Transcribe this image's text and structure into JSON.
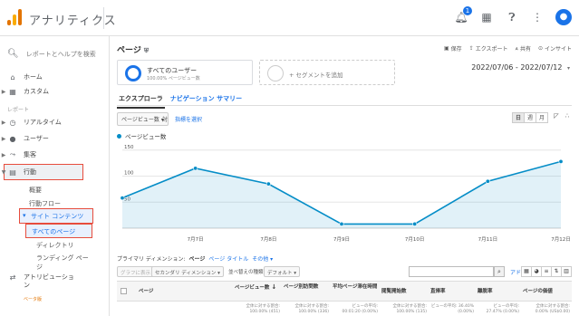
{
  "app": {
    "title": "アナリティクス"
  },
  "header": {
    "notification_count": "1"
  },
  "sidebar": {
    "search_placeholder": "レポートとヘルプを検索",
    "home": "ホーム",
    "custom": "カスタム",
    "report_section": "レポート",
    "realtime": "リアルタイム",
    "users": "ユーザー",
    "acquisition": "集客",
    "behavior": "行動",
    "overview": "概要",
    "behavior_flow": "行動フロー",
    "site_content": "サイト コンテンツ",
    "all_pages": "すべてのページ",
    "directory": "ディレクトリ",
    "landing_page": "ランディング ペー\nジ",
    "attribution": "アトリビューショ\nン",
    "beta": "ベータ版"
  },
  "page": {
    "title": "ページ",
    "actions": {
      "save": "保存",
      "export": "エクスポート",
      "share": "共有",
      "insight": "インサイト"
    },
    "segment": {
      "all_users": "すべてのユーザー",
      "all_users_sub": "100.00% ページビュー数",
      "add": "+ セグメントを追加"
    },
    "date_range": "2022/07/06 - 2022/07/12",
    "tabs": {
      "explorer": "エクスプローラ",
      "nav_summary": "ナビゲーション サマリー"
    }
  },
  "chart_controls": {
    "metric": "ページビュー数",
    "vs": "対",
    "pick_metric": "指標を選択",
    "period": [
      "日",
      "週",
      "月"
    ]
  },
  "chart_data": {
    "type": "area",
    "legend": "ページビュー数",
    "x": [
      "2022/07/06",
      "2022/07/07",
      "2022/07/08",
      "2022/07/09",
      "2022/07/10",
      "2022/07/11",
      "2022/07/12"
    ],
    "x_tick_labels": [
      "7月7日",
      "7月8日",
      "7月9日",
      "7月10日",
      "7月11日",
      "7月12日"
    ],
    "y_ticks": [
      150,
      100,
      50
    ],
    "ylim": [
      0,
      160
    ],
    "values": [
      58,
      115,
      85,
      8,
      8,
      90,
      128
    ],
    "color": "#058dc7"
  },
  "dimension": {
    "label": "プライマリ ディメンション:",
    "page": "ページ",
    "page_title": "ページ タイトル",
    "other": "その他"
  },
  "filters": {
    "plot_rows": "グラフに表示",
    "secondary_dim": "セカンダリ ディメンション",
    "sort_type": "並べ替えの種類:",
    "default": "デフォルト",
    "advanced": "アドバンス"
  },
  "table": {
    "headers": [
      "ページ",
      "ページビュー数",
      "ページ別訪問数",
      "平均ページ滞在時間",
      "閲覧開始数",
      "直帰率",
      "離脱率",
      "ページの価値"
    ],
    "totals": [
      "全体に対する割合: 100.00% (451)",
      "全体に対する割合: 100.00% (336)",
      "ビューの平均: 00:01:20 (0.00%)",
      "全体に対する割合: 100.00% (135)",
      "ビューの平均: 36.40% (0.00%)",
      "ビューの平均: 27.47% (0.00%)",
      "全体に対する割合: 0.00% (US$0.00)"
    ]
  }
}
